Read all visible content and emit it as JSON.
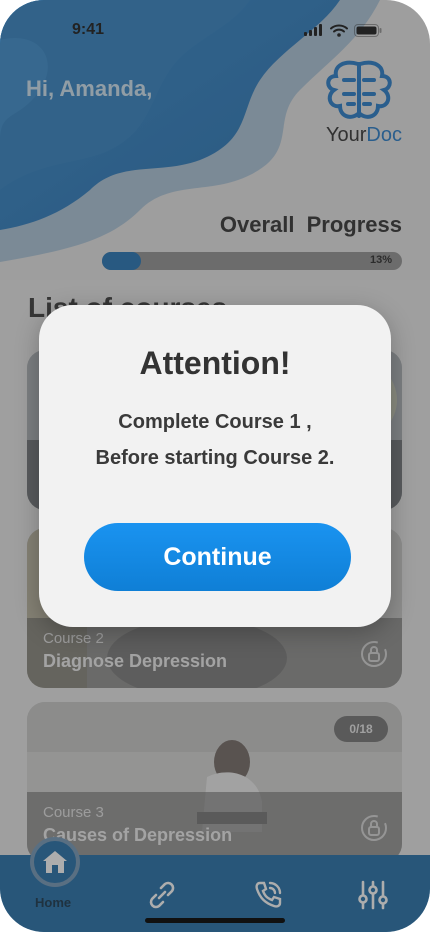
{
  "status": {
    "time": "9:41"
  },
  "header": {
    "greeting": "Hi, Amanda,",
    "logo_text_a": "Your",
    "logo_text_b": "Doc",
    "logo_icon": "brain-icon"
  },
  "progress": {
    "title": "Overall  Progress",
    "percent_label": "13%",
    "fraction": 0.13
  },
  "courses": {
    "title": "List of courses",
    "items": [
      {
        "number": "Course 2",
        "title": "Diagnose Depression",
        "locked": true
      },
      {
        "number": "Course 3",
        "title": "Causes of Depression",
        "badge": "0/18",
        "locked": true
      }
    ]
  },
  "nav": {
    "home_label": "Home",
    "icons": [
      "home-icon",
      "link-icon",
      "phone-icon",
      "sliders-icon"
    ]
  },
  "modal": {
    "title": "Attention!",
    "line1": "Complete Course 1 ,",
    "line2": "Before starting Course 2.",
    "button": "Continue"
  },
  "colors": {
    "brand": "#1b6aa6",
    "accent": "#1a93f0"
  }
}
